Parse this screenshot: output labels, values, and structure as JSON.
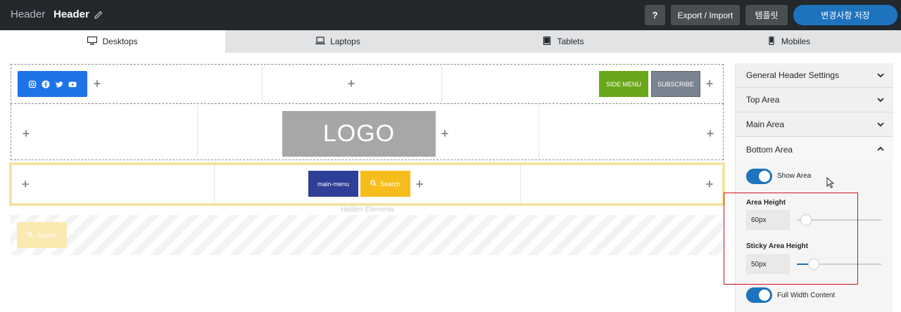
{
  "topbar": {
    "context_label": "Header",
    "title": "Header",
    "help_label": "?",
    "export_label": "Export / Import",
    "template_label": "템플릿",
    "save_label": "변경사항 저장"
  },
  "device_tabs": [
    {
      "label": "Desktops",
      "icon": "desktop-icon",
      "active": true
    },
    {
      "label": "Laptops",
      "icon": "laptop-icon",
      "active": false
    },
    {
      "label": "Tablets",
      "icon": "tablet-icon",
      "active": false
    },
    {
      "label": "Mobiles",
      "icon": "mobile-icon",
      "active": false
    }
  ],
  "builder": {
    "top_row": {
      "social_icons": [
        "instagram-icon",
        "facebook-icon",
        "twitter-icon",
        "youtube-icon"
      ],
      "side_menu_label": "SIDE MENU",
      "subscribe_label": "SUBSCRIBE"
    },
    "main_row": {
      "logo_text": "LOGO"
    },
    "bottom_row": {
      "menu_label": "main-menu",
      "search_label": "Search"
    },
    "hidden": {
      "label": "Hidden Elements",
      "search_label": "Search"
    },
    "add_symbol": "+"
  },
  "panel": {
    "sections": [
      {
        "label": "General Header Settings",
        "open": false
      },
      {
        "label": "Top Area",
        "open": false
      },
      {
        "label": "Main Area",
        "open": false
      },
      {
        "label": "Bottom Area",
        "open": true
      }
    ],
    "show_area_label": "Show Area",
    "show_area_on": true,
    "area_height": {
      "label": "Area Height",
      "value": "60px",
      "slider_fraction": 0.05
    },
    "sticky_area_height": {
      "label": "Sticky Area Height",
      "value": "50px",
      "slider_fraction": 0.15
    },
    "full_width_label": "Full Width Content",
    "full_width_on": true
  },
  "colors": {
    "topbar_bg": "#23282d",
    "primary_blue": "#1e73be",
    "social_blue": "#1e73e8",
    "side_menu_green": "#6aa71a",
    "subscribe_gray": "#7a8391",
    "menu_navy": "#2f3e96",
    "search_yellow": "#f7bd1c",
    "highlight_yellow": "#f3e3a4",
    "annotation_red": "#d0101e"
  }
}
